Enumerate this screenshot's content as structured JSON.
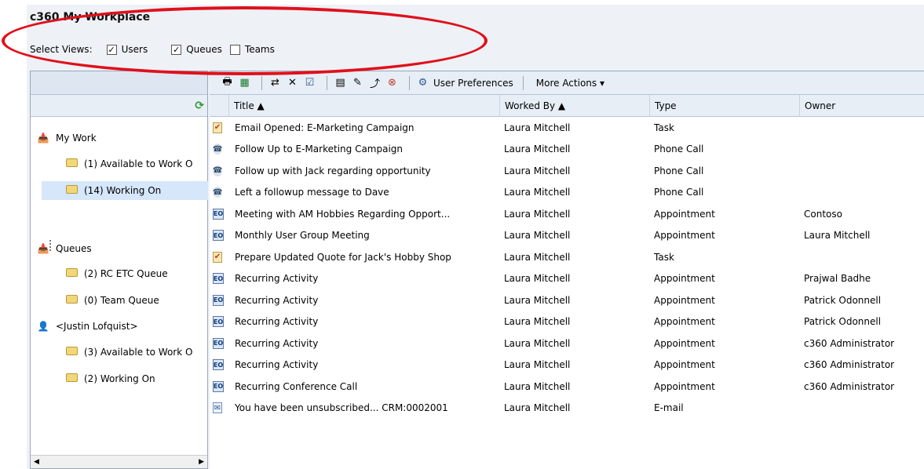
{
  "header": {
    "title": "c360 My Workplace"
  },
  "views": {
    "label": "Select Views:",
    "options": [
      {
        "label": "Users",
        "checked": true
      },
      {
        "label": "Queues",
        "checked": true
      },
      {
        "label": "Teams",
        "checked": false
      }
    ]
  },
  "toolbar": {
    "user_preferences": "User Preferences",
    "more_actions": "More Actions ▾"
  },
  "sidebar": {
    "items": [
      {
        "label": "My Work",
        "icon": "user-folder-icon"
      },
      {
        "label": "(1) Available to Work O",
        "icon": "folder-icon"
      },
      {
        "label": "(14) Working On",
        "icon": "folder-icon",
        "selected": true
      },
      {
        "label": "Queues",
        "icon": "user-folder-icon"
      },
      {
        "label": "(2) RC ETC Queue",
        "icon": "folder-icon"
      },
      {
        "label": "(0) Team Queue",
        "icon": "folder-icon"
      },
      {
        "label": "<Justin Lofquist>",
        "icon": "person-icon"
      },
      {
        "label": "(3) Available to Work O",
        "icon": "folder-icon"
      },
      {
        "label": "(2) Working On",
        "icon": "folder-icon"
      }
    ]
  },
  "grid": {
    "columns": [
      "Title ▲",
      "Worked By ▲",
      "Type",
      "Owner"
    ],
    "rows": [
      {
        "icon": "task",
        "title": "Email Opened: E-Marketing Campaign",
        "worked_by": "Laura Mitchell",
        "type": "Task",
        "owner": ""
      },
      {
        "icon": "phone",
        "title": "Follow Up to E-Marketing Campaign",
        "worked_by": "Laura Mitchell",
        "type": "Phone Call",
        "owner": ""
      },
      {
        "icon": "phone",
        "title": "Follow up with Jack regarding opportunity",
        "worked_by": "Laura Mitchell",
        "type": "Phone Call",
        "owner": ""
      },
      {
        "icon": "phone",
        "title": "Left a followup message to Dave",
        "worked_by": "Laura Mitchell",
        "type": "Phone Call",
        "owner": ""
      },
      {
        "icon": "appt",
        "title": "Meeting with AM Hobbies Regarding Opport...",
        "worked_by": "Laura Mitchell",
        "type": "Appointment",
        "owner": "Contoso"
      },
      {
        "icon": "appt",
        "title": "Monthly User Group Meeting",
        "worked_by": "Laura Mitchell",
        "type": "Appointment",
        "owner": "Laura Mitchell"
      },
      {
        "icon": "task",
        "title": "Prepare Updated Quote for Jack's Hobby Shop",
        "worked_by": "Laura Mitchell",
        "type": "Task",
        "owner": ""
      },
      {
        "icon": "appt",
        "title": "Recurring Activity",
        "worked_by": "Laura Mitchell",
        "type": "Appointment",
        "owner": "Prajwal Badhe"
      },
      {
        "icon": "appt",
        "title": "Recurring Activity",
        "worked_by": "Laura Mitchell",
        "type": "Appointment",
        "owner": "Patrick Odonnell"
      },
      {
        "icon": "appt",
        "title": "Recurring Activity",
        "worked_by": "Laura Mitchell",
        "type": "Appointment",
        "owner": "Patrick Odonnell"
      },
      {
        "icon": "appt",
        "title": "Recurring Activity",
        "worked_by": "Laura Mitchell",
        "type": "Appointment",
        "owner": "c360 Administrator"
      },
      {
        "icon": "appt",
        "title": "Recurring Activity",
        "worked_by": "Laura Mitchell",
        "type": "Appointment",
        "owner": "c360 Administrator"
      },
      {
        "icon": "appt",
        "title": "Recurring Conference Call",
        "worked_by": "Laura Mitchell",
        "type": "Appointment",
        "owner": "c360 Administrator"
      },
      {
        "icon": "mail",
        "title": "You have been unsubscribed... CRM:0002001",
        "worked_by": "Laura Mitchell",
        "type": "E-mail",
        "owner": ""
      }
    ]
  },
  "colors": {
    "annotation": "#e0101b",
    "selected": "#d6e6fb",
    "header_bg": "#e8eef6"
  }
}
